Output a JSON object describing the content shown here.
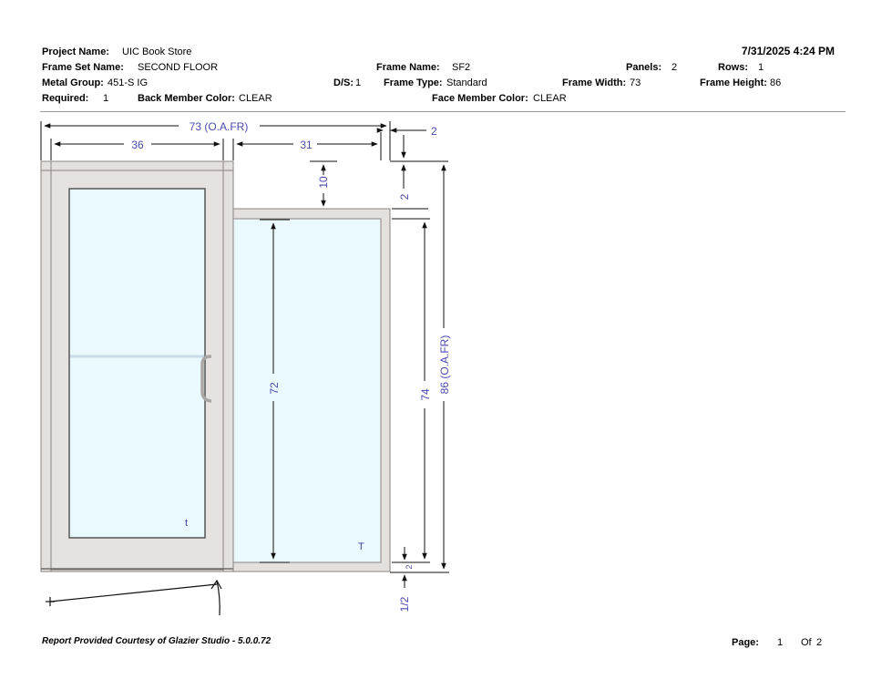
{
  "header": {
    "project_name_label": "Project Name:",
    "project_name": "UIC Book Store",
    "datetime": "7/31/2025 4:24 PM",
    "frame_set_name_label": "Frame Set Name:",
    "frame_set_name": "SECOND FLOOR",
    "frame_name_label": "Frame Name:",
    "frame_name": "SF2",
    "panels_label": "Panels:",
    "panels": "2",
    "rows_label": "Rows:",
    "rows": "1",
    "metal_group_label": "Metal Group:",
    "metal_group": "451-S IG",
    "ds_label": "D/S:",
    "ds": "1",
    "frame_type_label": "Frame Type:",
    "frame_type": "Standard",
    "frame_width_label": "Frame Width:",
    "frame_width": "73",
    "frame_height_label": "Frame Height:",
    "frame_height": "86",
    "required_label": "Required:",
    "required": "1",
    "back_color_label": "Back Member Color:",
    "back_color": "CLEAR",
    "face_color_label": "Face Member Color:",
    "face_color": "CLEAR"
  },
  "drawing": {
    "overall_width": "73 (O.A.FR)",
    "door_width": "36",
    "sidelite_width": "31",
    "member_width": "2",
    "head_offset": "10",
    "head_member": "2",
    "dlo_height": "72",
    "sidelite_height": "74",
    "overall_height": "86 (O.A.FR)",
    "sill_member": "2",
    "sill_gap": "1/2",
    "door_glass_mark": "t",
    "sidelite_glass_mark": "T",
    "colors": {
      "frame": "#e4e0de",
      "frame_edge": "#8a8482",
      "glass": "#eaf9fd",
      "dimension_text": "#4a4ab0"
    }
  },
  "footer": {
    "courtesy": "Report Provided Courtesy of Glazier Studio - 5.0.0.72",
    "page_label": "Page:",
    "page": "1",
    "of_label": "Of",
    "total": "2"
  }
}
